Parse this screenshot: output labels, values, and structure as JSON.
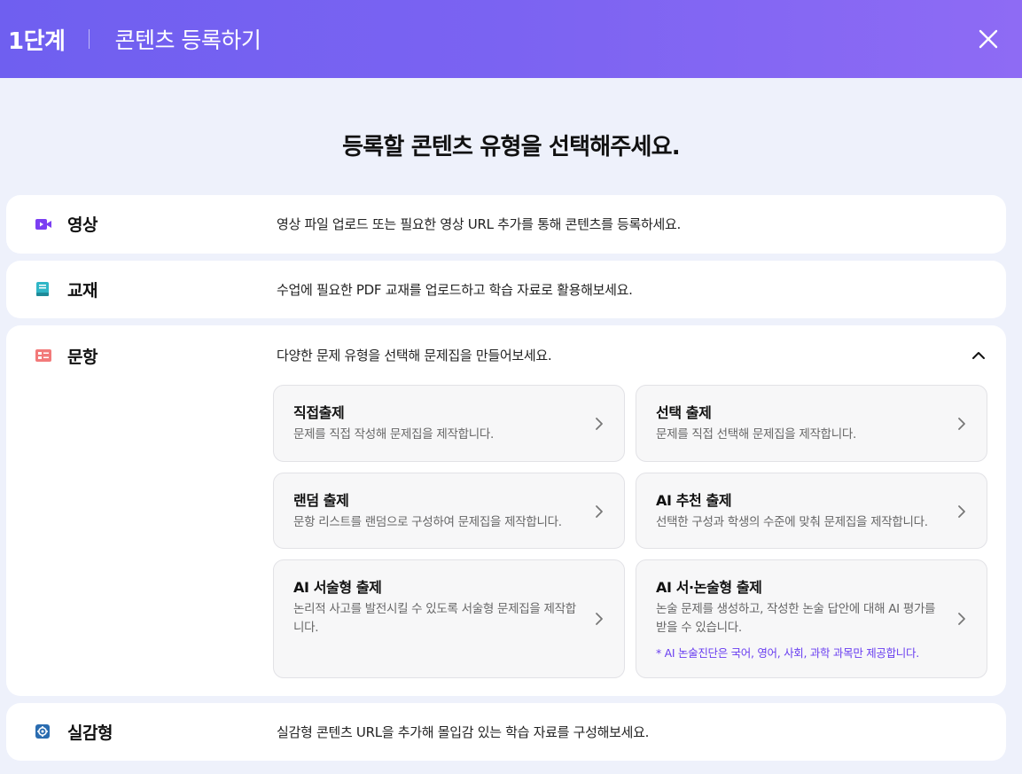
{
  "header": {
    "step": "1단계",
    "title": "콘텐츠 등록하기",
    "close_icon": "close-icon"
  },
  "heading": "등록할 콘텐츠 유형을 선택해주세요.",
  "content_types": {
    "video": {
      "icon": "video-camera-icon",
      "icon_color": "#7b3ff2",
      "title": "영상",
      "description": "영상 파일 업로드 또는 필요한 영상 URL 추가를 통해 콘텐츠를 등록하세요."
    },
    "textbook": {
      "icon": "book-icon",
      "icon_color": "#2fb6c6",
      "title": "교재",
      "description": "수업에 필요한 PDF 교재를 업로드하고 학습 자료로 활용해보세요."
    },
    "question": {
      "icon": "question-card-icon",
      "icon_color": "#f27a7a",
      "title": "문항",
      "description": "다양한 문제 유형을 선택해 문제집을 만들어보세요.",
      "expanded": true,
      "options": [
        {
          "title": "직접출제",
          "description": "문제를 직접 작성해 문제집을 제작합니다."
        },
        {
          "title": "선택 출제",
          "description": "문제를 직접 선택해 문제집을 제작합니다."
        },
        {
          "title": "랜덤 출제",
          "description": "문항 리스트를 랜덤으로 구성하여 문제집을 제작합니다."
        },
        {
          "title": "AI 추천 출제",
          "description": "선택한 구성과 학생의 수준에 맞춰 문제집을 제작합니다."
        },
        {
          "title": "AI 서술형 출제",
          "description": "논리적 사고를 발전시킬 수 있도록 서술형 문제집을 제작합니다."
        },
        {
          "title": "AI 서·논술형 출제",
          "description": "논술 문제를 생성하고, 작성한 논술 답안에 대해 AI 평가를 받을 수 있습니다.",
          "note": "* AI 논술진단은 국어, 영어, 사회, 과학 과목만 제공합니다."
        }
      ]
    },
    "immersive": {
      "icon": "immersive-gear-icon",
      "icon_color": "#2a6cb0",
      "title": "실감형",
      "description": "실감형 콘텐츠 URL을 추가해 몰입감 있는 학습 자료를 구성해보세요."
    }
  },
  "colors": {
    "header_gradient_start": "#6f5ff0",
    "header_gradient_end": "#8e6bf4",
    "background": "#eef1fb",
    "note": "#6a3ff0"
  }
}
